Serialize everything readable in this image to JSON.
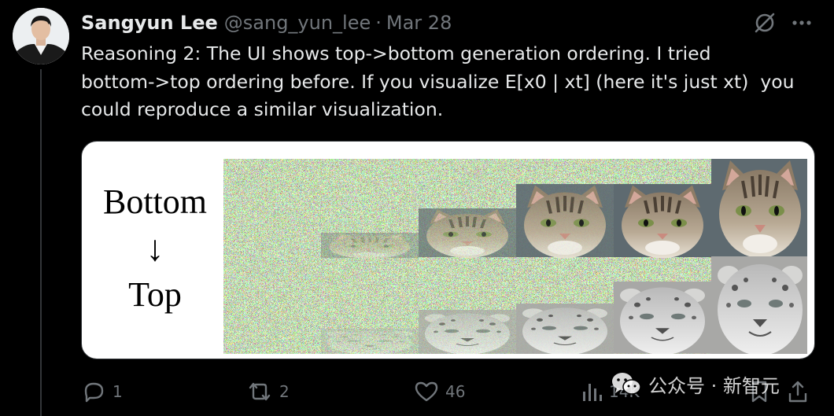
{
  "tweet": {
    "author_name": "Sangyun Lee",
    "handle": "@sang_yun_lee",
    "separator": "·",
    "date": "Mar 28",
    "text": "Reasoning 2: The UI shows top->bottom generation ordering. I tried\nbottom->top ordering before. If you visualize E[x0 | xt] (here it's just xt)  you\ncould reproduce a similar visualization."
  },
  "figure": {
    "label_bottom": "Bottom",
    "label_arrow": "↓",
    "label_top": "Top"
  },
  "actions": {
    "reply_count": "1",
    "repost_count": "2",
    "like_count": "46",
    "views_count": "14K"
  },
  "watermark": {
    "text": "公众号 · 新智元"
  },
  "colors": {
    "background": "#000000",
    "primary_text": "#e7e9ea",
    "secondary_text": "#71767b",
    "thread_line": "#333639"
  },
  "icons": {
    "grok": "grok-icon",
    "more": "more-horizontal-icon",
    "reply": "reply-icon",
    "repost": "repost-icon",
    "like": "heart-icon",
    "views": "views-bar-chart-icon",
    "bookmark": "bookmark-icon",
    "share": "share-icon"
  }
}
